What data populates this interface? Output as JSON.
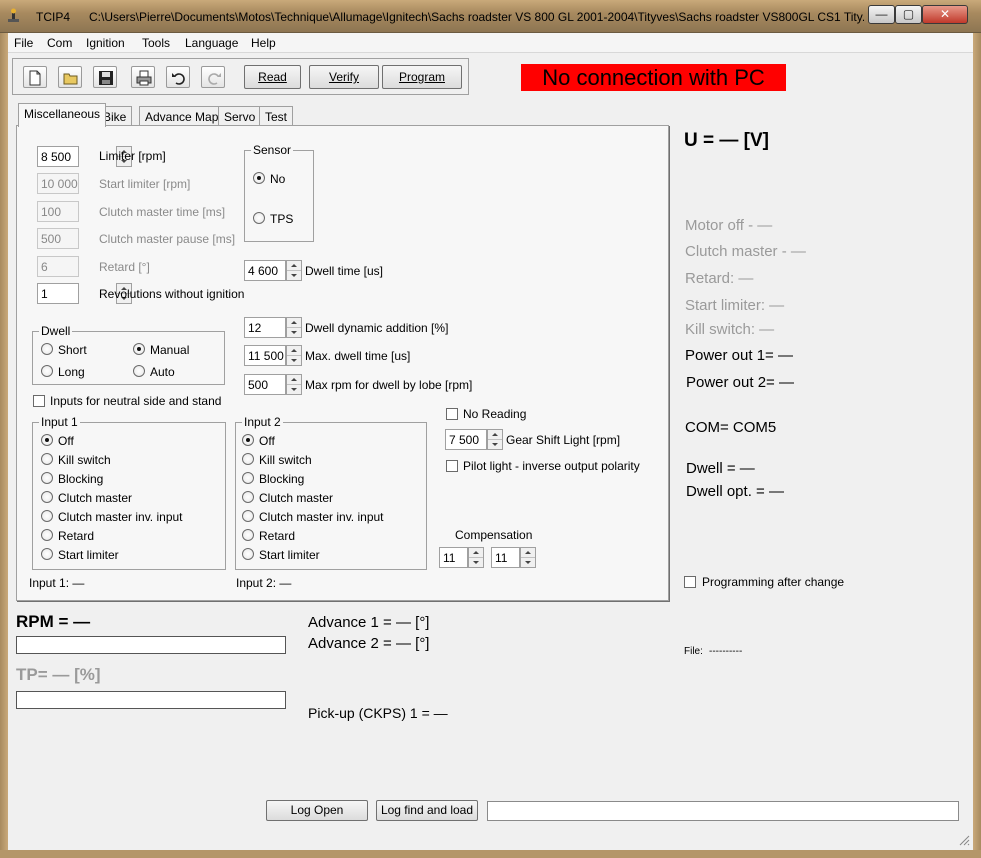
{
  "window": {
    "app_title": "TCIP4",
    "path_title": "C:\\Users\\Pierre\\Documents\\Motos\\Technique\\Allumage\\Ignitech\\Sachs roadster VS 800 GL 2001-2004\\Tityves\\Sachs roadster VS800GL CS1 Tity...",
    "minimize": "—",
    "maximize": "▢",
    "close": "✕"
  },
  "menu": [
    "File",
    "Com",
    "Ignition",
    "Tools",
    "Language",
    "Help"
  ],
  "toolbar": {
    "icons": [
      "new-file-icon",
      "open-folder-icon",
      "save-icon",
      "print-icon",
      "undo-icon",
      "redo-icon"
    ],
    "read_label": "Read",
    "verify_label": "Verify",
    "program_label": "Program"
  },
  "connection_status": "No connection with PC",
  "tabs": [
    "Miscellaneous",
    "Bike",
    "Advance Map",
    "Servo",
    "Test"
  ],
  "misc": {
    "limiter": {
      "value": "8 500",
      "label": "Limiter [rpm]"
    },
    "start_limiter": {
      "value": "10 000",
      "label": "Start limiter [rpm]"
    },
    "clutch_time": {
      "value": "100",
      "label": "Clutch master time [ms]"
    },
    "clutch_pause": {
      "value": "500",
      "label": "Clutch master pause [ms]"
    },
    "retard": {
      "value": "6",
      "label": "Retard [°]"
    },
    "revolutions": {
      "value": "1",
      "label": "Revolutions without ignition"
    },
    "sensor": {
      "title": "Sensor",
      "no": "No",
      "tps": "TPS"
    },
    "dwell_time": {
      "value": "4 600",
      "label": "Dwell time [us]"
    },
    "dwell": {
      "title": "Dwell",
      "short": "Short",
      "manual": "Manual",
      "long": "Long",
      "auto": "Auto"
    },
    "dwell_dyn": {
      "value": "12",
      "label": "Dwell dynamic addition [%]"
    },
    "max_dwell": {
      "value": "11 500",
      "label": "Max. dwell time [us]"
    },
    "max_rpm_dwell": {
      "value": "500",
      "label": "Max rpm for dwell by lobe [rpm]"
    },
    "neutral_label": "Inputs for neutral side and stand",
    "input1": {
      "title": "Input 1",
      "options": [
        "Off",
        "Kill switch",
        "Blocking",
        "Clutch master",
        "Clutch master inv. input",
        "Retard",
        "Start limiter"
      ],
      "status": "Input 1: —"
    },
    "input2": {
      "title": "Input 2",
      "options": [
        "Off",
        "Kill switch",
        "Blocking",
        "Clutch master",
        "Clutch master inv. input",
        "Retard",
        "Start limiter"
      ],
      "status": "Input 2: —"
    },
    "no_reading": "No Reading",
    "gear_shift": {
      "value": "7 500",
      "label": "Gear Shift Light [rpm]"
    },
    "pilot_light": "Pilot light - inverse output polarity",
    "compensation": {
      "title": "Compensation",
      "a": "11",
      "b": "11"
    }
  },
  "readouts": {
    "voltage": "U = — [V]",
    "motor_off": "Motor off - —",
    "clutch_master": "Clutch master - —",
    "retard": "Retard: —",
    "start_limiter": "Start limiter: —",
    "kill_switch": "Kill switch: —",
    "power_out1": "Power out 1= —",
    "power_out2": "Power out 2= —",
    "com": "COM= COM5",
    "dwell": "Dwell = —",
    "dwell_opt": "Dwell opt. = —",
    "programming_after_change": "Programming after change",
    "file_label": "File:",
    "file_value": "----------"
  },
  "bottom": {
    "rpm": "RPM = —",
    "tp": "TP= — [%]",
    "advance1": "Advance 1 = — [°]",
    "advance2": "Advance 2 = — [°]",
    "pickup": "Pick-up (CKPS) 1 = —",
    "log_open": "Log Open",
    "log_find": "Log find and load"
  }
}
